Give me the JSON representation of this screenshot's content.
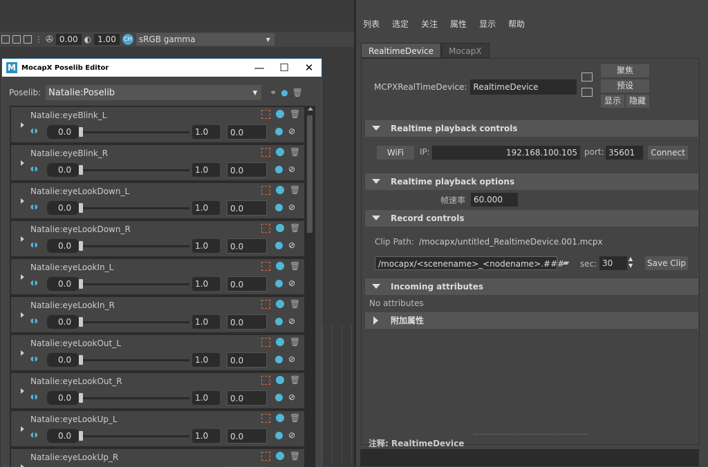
{
  "viewport": {
    "val1": "0.00",
    "val2": "1.00",
    "colorspace": "sRGB gamma",
    "badge": "CH"
  },
  "editor": {
    "title": "MocapX Poselib Editor",
    "logo": "M",
    "poselib_label": "Poselib:",
    "poselib_value": "Natalie:Poselib",
    "items": [
      {
        "label": "Natalie:eyeBlink_L",
        "min": "0.0",
        "max": "1.0",
        "cur": "0.0"
      },
      {
        "label": "Natalie:eyeBlink_R",
        "min": "0.0",
        "max": "1.0",
        "cur": "0.0"
      },
      {
        "label": "Natalie:eyeLookDown_L",
        "min": "0.0",
        "max": "1.0",
        "cur": "0.0"
      },
      {
        "label": "Natalie:eyeLookDown_R",
        "min": "0.0",
        "max": "1.0",
        "cur": "0.0"
      },
      {
        "label": "Natalie:eyeLookIn_L",
        "min": "0.0",
        "max": "1.0",
        "cur": "0.0"
      },
      {
        "label": "Natalie:eyeLookIn_R",
        "min": "0.0",
        "max": "1.0",
        "cur": "0.0"
      },
      {
        "label": "Natalie:eyeLookOut_L",
        "min": "0.0",
        "max": "1.0",
        "cur": "0.0"
      },
      {
        "label": "Natalie:eyeLookOut_R",
        "min": "0.0",
        "max": "1.0",
        "cur": "0.0"
      },
      {
        "label": "Natalie:eyeLookUp_L",
        "min": "0.0",
        "max": "1.0",
        "cur": "0.0"
      },
      {
        "label": "Natalie:eyeLookUp_R",
        "min": "",
        "max": "",
        "cur": ""
      }
    ]
  },
  "attr": {
    "menu": [
      "列表",
      "选定",
      "关注",
      "属性",
      "显示",
      "帮助"
    ],
    "tabs": [
      "RealtimeDevice",
      "MocapX"
    ],
    "device_label": "MCPXRealTimeDevice:",
    "device_value": "RealtimeDevice",
    "btn_focus": "聚焦",
    "btn_preset": "预设",
    "btn_show": "显示",
    "btn_hide": "隐藏",
    "sec_playback": "Realtime playback controls",
    "wifi": "WiFi",
    "ip_label": "IP:",
    "ip_value": "192.168.100.105",
    "port_label": "port:",
    "port_value": "35601",
    "connect": "Connect",
    "sec_options": "Realtime playback options",
    "fps_label": "帧速率",
    "fps_value": "60.000",
    "sec_record": "Record controls",
    "clip_label": "Clip Path:",
    "clip_value": "/mocapx/untitled_RealtimeDevice.001.mcpx",
    "clip_pattern": "/mocapx/<scenename>_<nodename>.###",
    "sec_label": "sec:",
    "sec_value": "30",
    "save_clip": "Save Clip",
    "sec_incoming": "Incoming attributes",
    "no_attrs": "No attributes",
    "sec_extra": "附加属性",
    "notes_label": "注释:",
    "notes_value": "RealtimeDevice"
  }
}
